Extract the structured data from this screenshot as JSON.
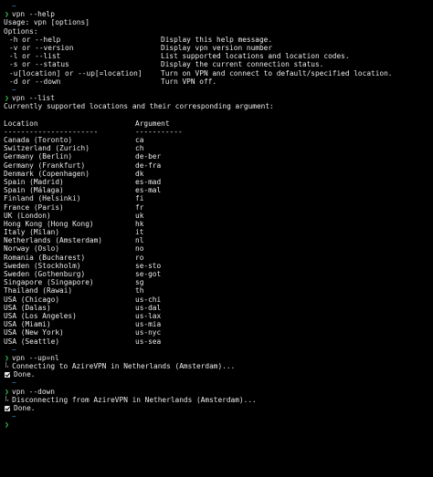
{
  "prompt": {
    "path": "~",
    "chevron": "❯",
    "apple": ""
  },
  "help": {
    "command": "vpn --help",
    "usage": "Usage: vpn [options]",
    "options_label": "Options:",
    "options": [
      {
        "flag": "-h or --help",
        "desc": "Display this help message."
      },
      {
        "flag": "-v or --version",
        "desc": "Display vpn version number"
      },
      {
        "flag": "-l or --list",
        "desc": "List supported locations and location codes."
      },
      {
        "flag": "-s or --status",
        "desc": "Display the current connection status."
      },
      {
        "flag": "-u[location] or --up[=location]",
        "desc": "Turn on VPN and connect to default/specified location."
      },
      {
        "flag": "-d or --down",
        "desc": "Turn VPN off."
      }
    ]
  },
  "list": {
    "command": "vpn --list",
    "intro": "Currently supported locations and their corresponding argument:",
    "header_location": "Location",
    "header_argument": "Argument",
    "sep_location": "----------------------",
    "sep_argument": "-----------",
    "rows": [
      {
        "loc": "Canada (Toronto)",
        "arg": "ca"
      },
      {
        "loc": "Switzerland (Zurich)",
        "arg": "ch"
      },
      {
        "loc": "Germany (Berlin)",
        "arg": "de-ber"
      },
      {
        "loc": "Germany (Frankfurt)",
        "arg": "de-fra"
      },
      {
        "loc": "Denmark (Copenhagen)",
        "arg": "dk"
      },
      {
        "loc": "Spain (Madrid)",
        "arg": "es-mad"
      },
      {
        "loc": "Spain (Málaga)",
        "arg": "es-mal"
      },
      {
        "loc": "Finland (Helsinki)",
        "arg": "fi"
      },
      {
        "loc": "France (Paris)",
        "arg": "fr"
      },
      {
        "loc": "UK (London)",
        "arg": "uk"
      },
      {
        "loc": "Hong Kong (Hong Kong)",
        "arg": "hk"
      },
      {
        "loc": "Italy (Milan)",
        "arg": "it"
      },
      {
        "loc": "Netherlands (Amsterdam)",
        "arg": "nl"
      },
      {
        "loc": "Norway (Oslo)",
        "arg": "no"
      },
      {
        "loc": "Romania (Bucharest)",
        "arg": "ro"
      },
      {
        "loc": "Sweden (Stockholm)",
        "arg": "se-sto"
      },
      {
        "loc": "Sweden (Gothenburg)",
        "arg": "se-got"
      },
      {
        "loc": "Singapore (Singapore)",
        "arg": "sg"
      },
      {
        "loc": "Thailand (Rawai)",
        "arg": "th"
      },
      {
        "loc": "USA (Chicago)",
        "arg": "us-chi"
      },
      {
        "loc": "USA (Dalas)",
        "arg": "us-dal"
      },
      {
        "loc": "USA (Los Angeles)",
        "arg": "us-lax"
      },
      {
        "loc": "USA (Miami)",
        "arg": "us-mia"
      },
      {
        "loc": "USA (New York)",
        "arg": "us-nyc"
      },
      {
        "loc": "USA (Seattle)",
        "arg": "us-sea"
      }
    ]
  },
  "up": {
    "command": "vpn --up=nl",
    "status": "Connecting to AzireVPN in Netherlands (Amsterdam)...",
    "done": "Done."
  },
  "down": {
    "command": "vpn --down",
    "status": "Disconnecting from AzireVPN in Netherlands (Amsterdam)...",
    "done": "Done."
  },
  "colors": {
    "path": "#3b8fd8",
    "chevron": "#32c84a",
    "text": "#ececec",
    "background": "#000000"
  }
}
